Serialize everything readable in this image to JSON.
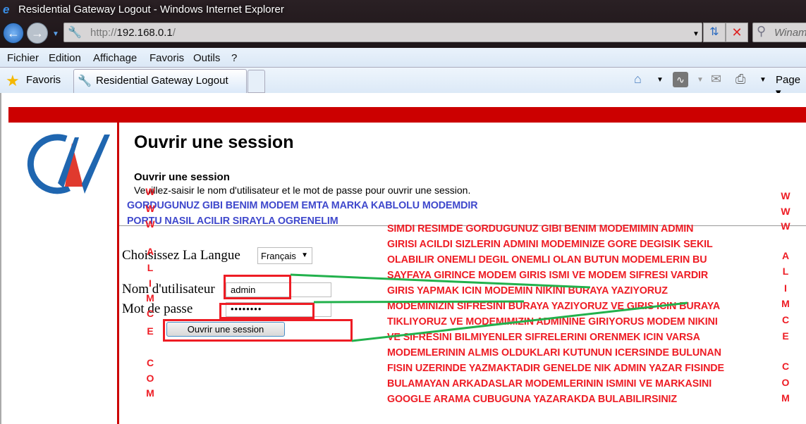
{
  "window": {
    "title": "Residential Gateway Logout - Windows Internet Explorer"
  },
  "address": {
    "url_prefix": "http://",
    "url_host": "192.168.0.1",
    "url_suffix": "/"
  },
  "search": {
    "placeholder": "Winam"
  },
  "menu": [
    "Fichier",
    "Edition",
    "Affichage",
    "Favoris",
    "Outils",
    "?"
  ],
  "favbar": {
    "favorites": "Favoris",
    "tab": "Residential Gateway Logout",
    "page": "Page"
  },
  "page": {
    "heading": "Ouvrir une session",
    "subheading": "Ouvrir une session",
    "instructions": "Veuillez-saisir le nom d'utilisateur et le mot de passe pour ouvrir une session.",
    "language_label": "Choisissez La Langue",
    "language_value": "Français",
    "username_label": "Nom d'utilisateur",
    "username_value": "admin",
    "password_label": "Mot de passe",
    "password_value": "••••••••",
    "login_button": "Ouvrir une session"
  },
  "annotations": {
    "blue": [
      "GORDUGUNUZ GIBI BENIM MODEM EMTA MARKA KABLOLU MODEMDIR",
      "PORTU NASIL ACILIR SIRAYLA OGRENELIM"
    ],
    "red": [
      "SIMDI RESIMDE GORDUGUNUZ GIBI BENIM MODEMIMIN ADMIN",
      "GIRISI ACILDI SIZLERIN ADMINI MODEMINIZE GORE DEGISIK SEKIL",
      "OLABILIR  ONEMLI DEGIL ONEMLI OLAN BUTUN MODEMLERIN BU",
      "SAYFAYA GIRINCE MODEM GIRIS ISMI VE MODEM SIFRESI VARDIR",
      "GIRIS YAPMAK ICIN MODEMIN NIKINI  BURAYA YAZIYORUZ",
      "MODEMINIZIN SIFRESINI BURAYA YAZIYORUZ VE GIRIS ICIN BURAYA",
      "TIKLIYORUZ VE MODEMIMIZIN ADMININE GIRIYORUS MODEM NIKINI",
      "VE SIFRESINI BILMIYENLER SIFRELERINI ORENMEK ICIN VARSA",
      "MODEMLERININ ALMIS OLDUKLARI KUTUNUN ICERSINDE BULUNAN",
      "FISIN UZERINDE YAZMAKTADIR  GENELDE NIK ADMIN YAZAR  FISINDE",
      "BULAMAYAN ARKADASLAR MODEMLERININ ISMINI VE MARKASINI",
      "GOOGLE ARAMA CUBUGUNA YAZARAKDA BULABILIRSINIZ"
    ],
    "watermark": [
      "W",
      "W",
      "W",
      "A",
      "L",
      "I",
      "M",
      "C",
      "E",
      "C",
      "O",
      "M"
    ]
  },
  "colors": {
    "brand_red": "#cc0000",
    "annotation_red": "#ee1c24",
    "annotation_blue": "#3f48cc",
    "annotation_green": "#22b14c"
  }
}
